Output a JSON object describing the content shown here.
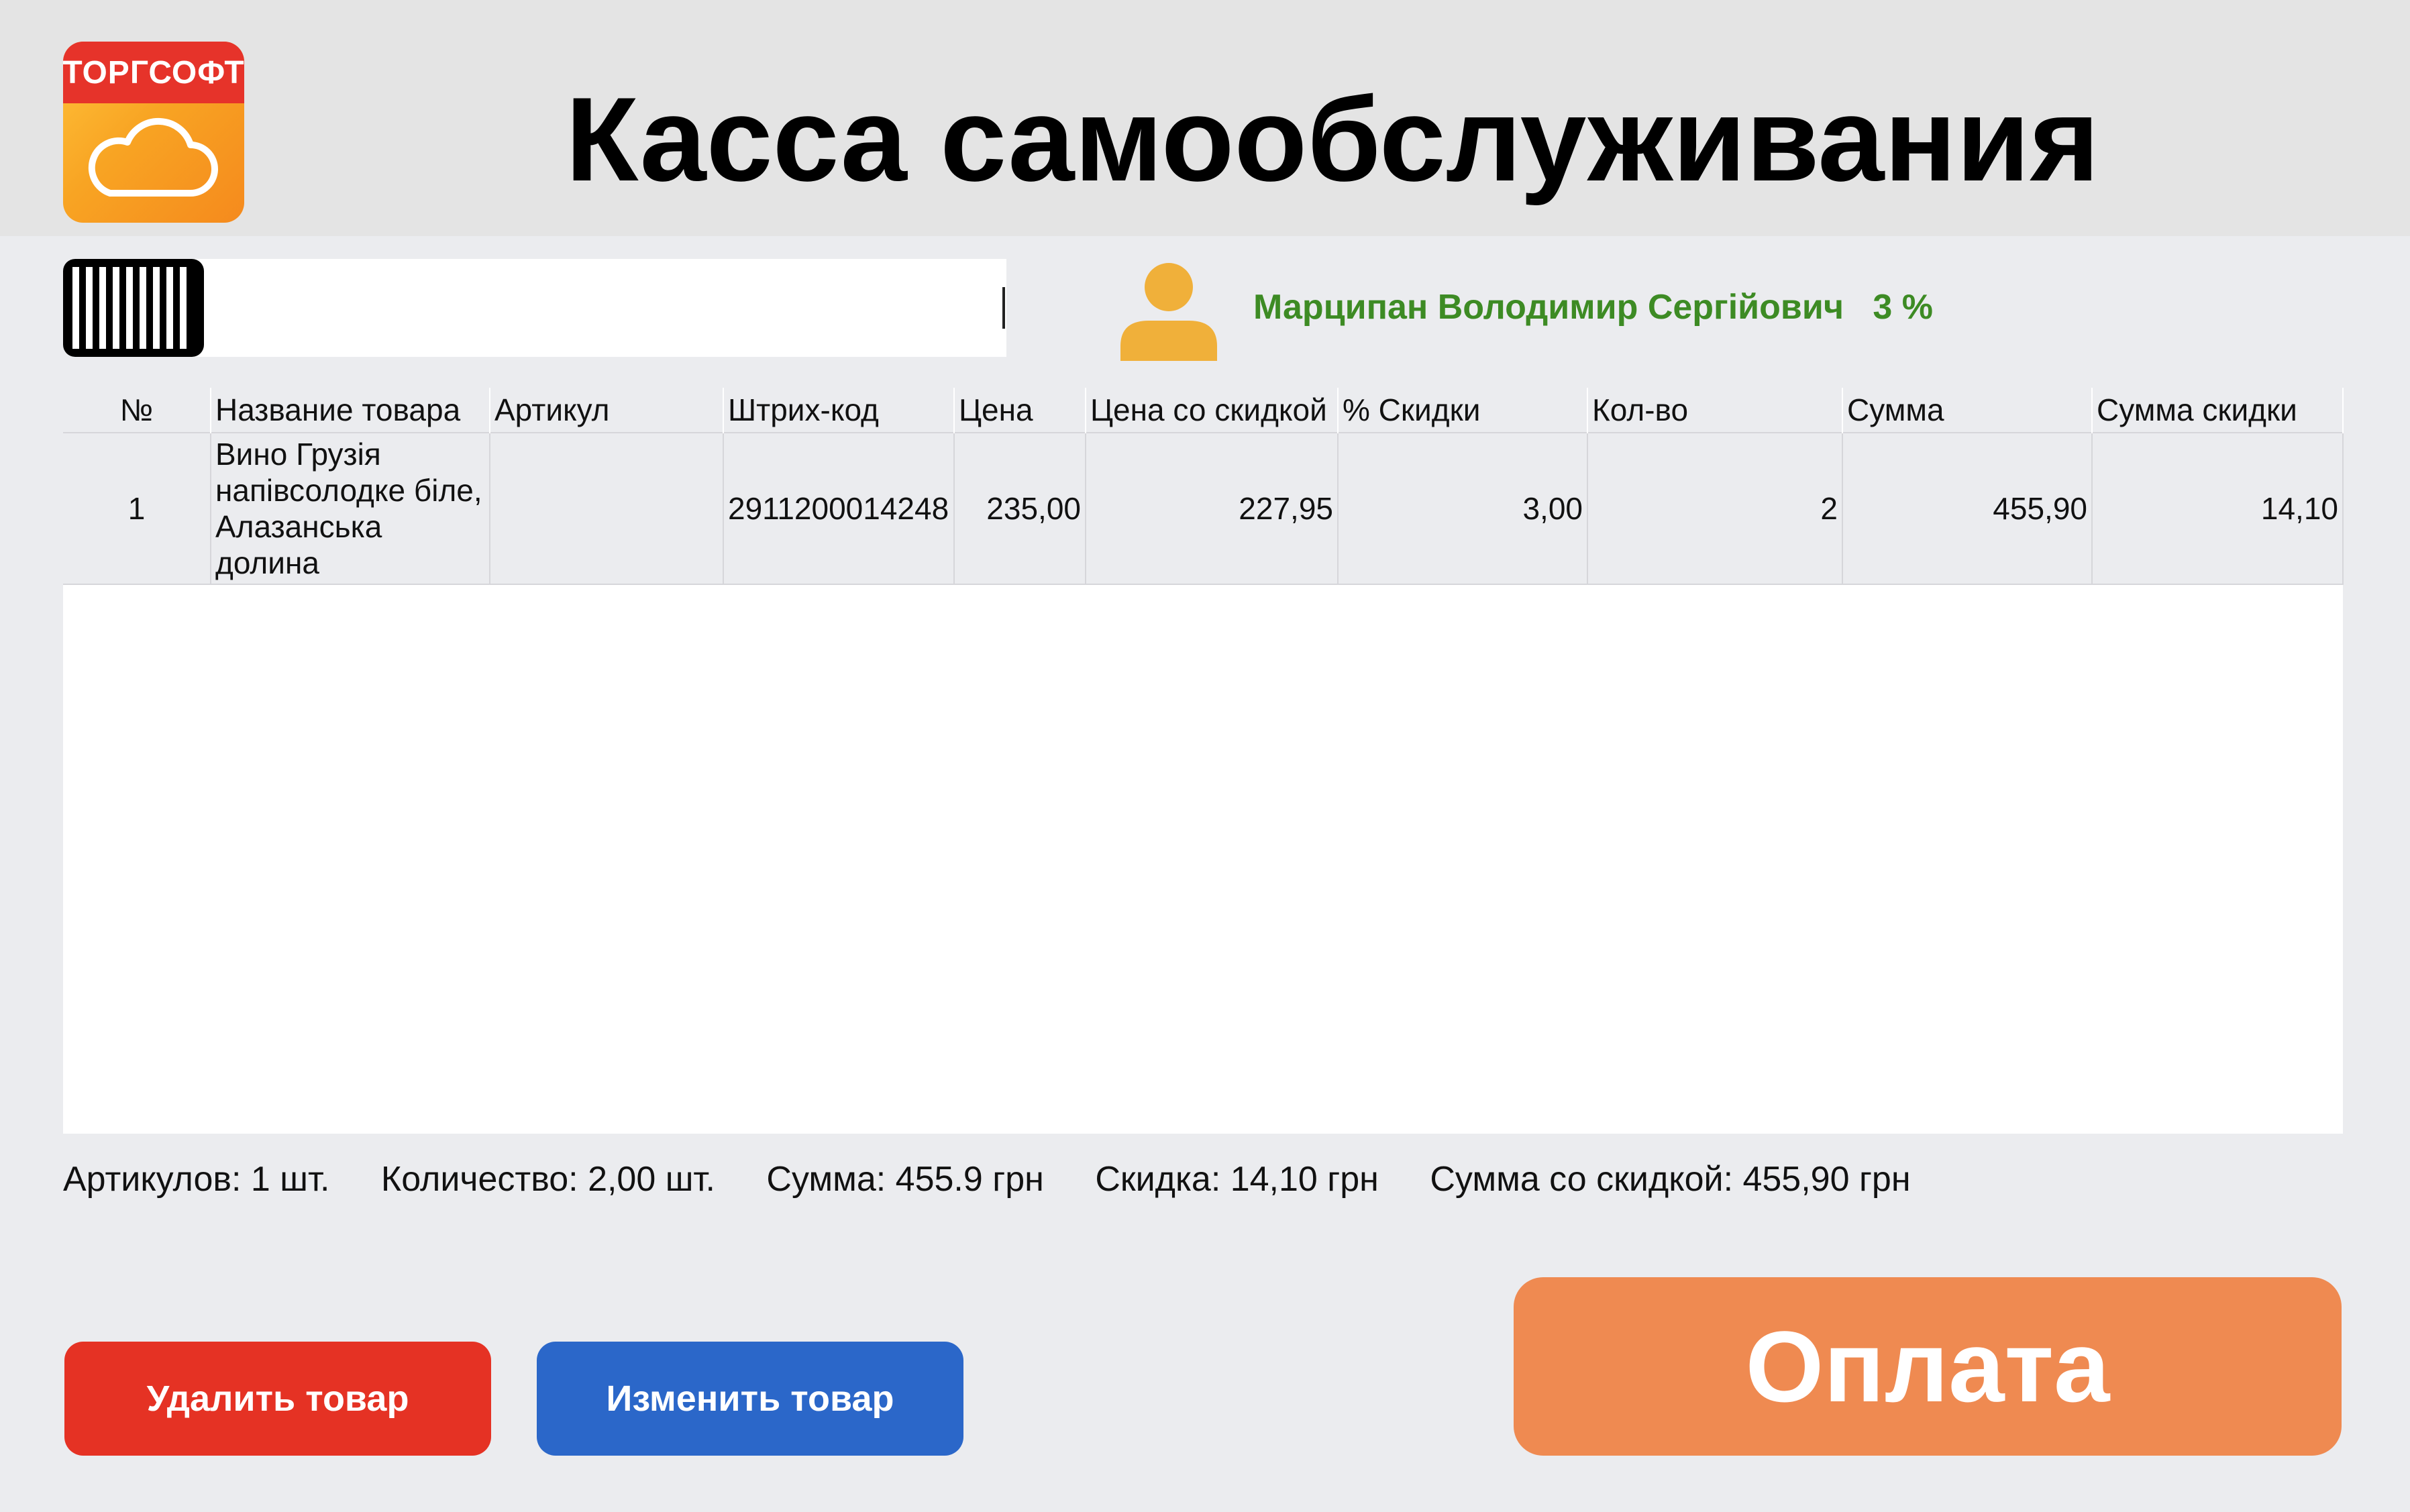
{
  "header": {
    "logo_text": "ТОРГСОФТ",
    "title": "Касса самообслуживания"
  },
  "scanner": {
    "value": ""
  },
  "customer": {
    "name": "Марципан Володимир Сергійович",
    "discount": "3 %"
  },
  "table": {
    "columns": [
      "№",
      "Название товара",
      "Артикул",
      "Штрих-код",
      "Цена",
      "Цена со скидкой",
      "% Скидки",
      "Кол-во",
      "Сумма",
      "Сумма скидки"
    ],
    "rows": [
      {
        "no": "1",
        "name": "Вино Грузія напівсолодке біле, Алазанська долина",
        "article": "",
        "barcode": "2911200014248",
        "price": "235,00",
        "discount_price": "227,95",
        "discount_percent": "3,00",
        "qty": "2",
        "sum": "455,90",
        "discount_sum": "14,10"
      }
    ]
  },
  "totals": {
    "articles": "Артикулов: 1 шт.",
    "quantity": "Количество: 2,00 шт.",
    "sum": "Сумма: 455.9 грн",
    "discount": "Скидка: 14,10 грн",
    "sum_discounted": "Сумма со скидкой: 455,90 грн"
  },
  "buttons": {
    "delete": "Удалить товар",
    "edit": "Изменить товар",
    "pay": "Оплата"
  },
  "colors": {
    "customer_text": "#3d8b24",
    "delete_button": "#e53224",
    "edit_button": "#2b67c9",
    "pay_button": "#ef8a51",
    "logo_red": "#e6332a",
    "logo_orange": "#f8a423",
    "customer_icon": "#f0b03a"
  }
}
